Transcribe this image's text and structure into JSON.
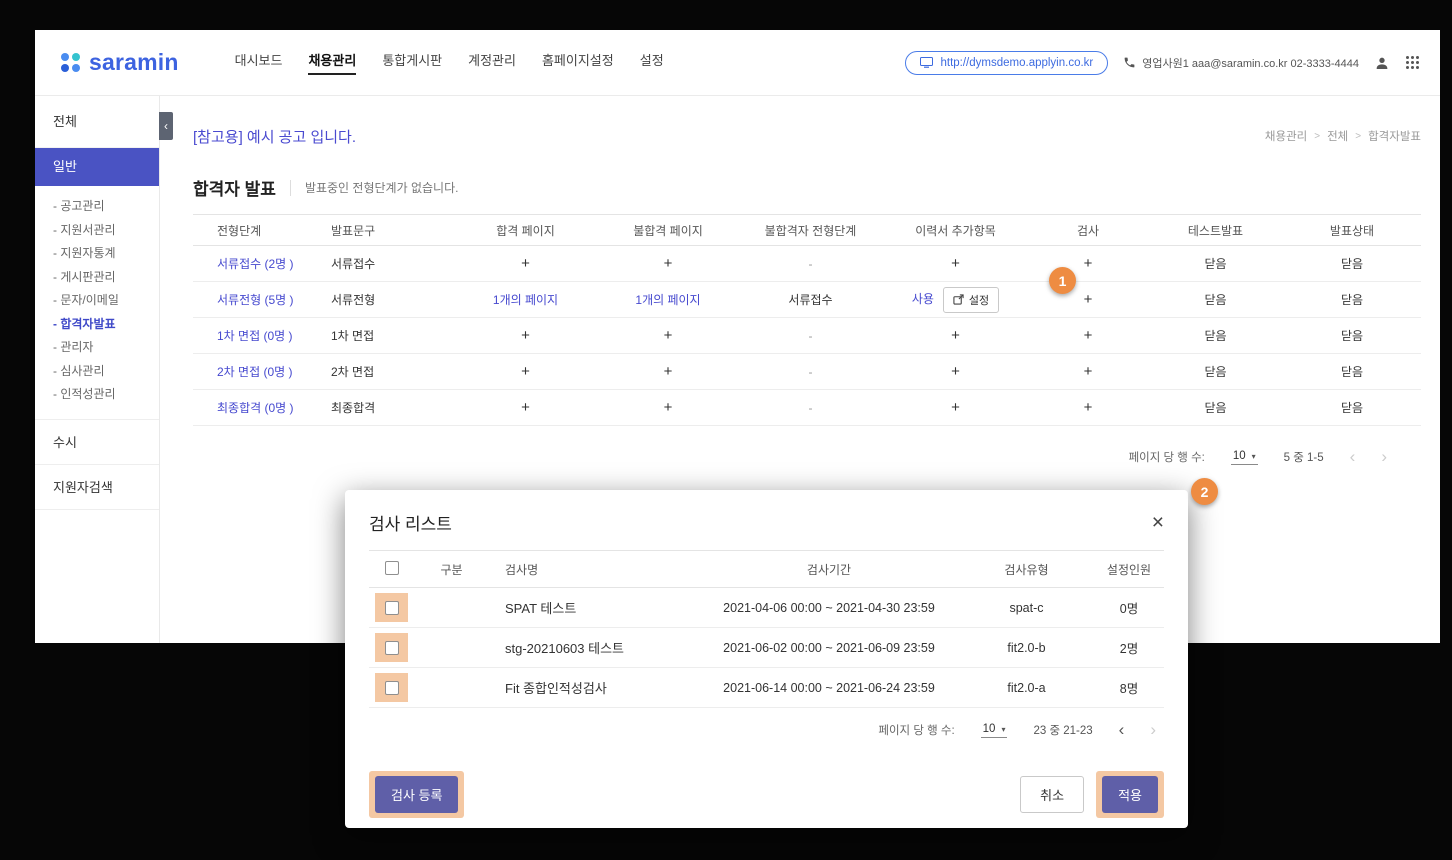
{
  "colors": {
    "primary_indigo": "#4a53c3",
    "link_blue": "#4649cf",
    "brand_blue": "#3d63e0",
    "badge_orange": "#ee8c42",
    "highlight_peach": "#f4c8a3"
  },
  "header": {
    "logo": "saramin",
    "nav": [
      {
        "label": "대시보드"
      },
      {
        "label": "채용관리"
      },
      {
        "label": "통합게시판"
      },
      {
        "label": "계정관리"
      },
      {
        "label": "홈페이지설정"
      },
      {
        "label": "설정"
      }
    ],
    "site_url": "http://dymsdemo.applyin.co.kr",
    "contact": "영업사원1 aaa@saramin.co.kr 02-3333-4444"
  },
  "sidebar": {
    "all_label": "전체",
    "collapse_icon": "‹",
    "group_label": "일반",
    "items": [
      {
        "label": "- 공고관리"
      },
      {
        "label": "- 지원서관리"
      },
      {
        "label": "- 지원자통계"
      },
      {
        "label": "- 게시판관리"
      },
      {
        "label": "- 문자/이메일"
      },
      {
        "label": "- 합격자발표"
      },
      {
        "label": "- 관리자"
      },
      {
        "label": "- 심사관리"
      },
      {
        "label": "- 인적성관리"
      }
    ],
    "susi_label": "수시",
    "search_label": "지원자검색"
  },
  "page": {
    "notice_title": "[참고용] 예시 공고 입니다.",
    "breadcrumb": {
      "a": "채용관리",
      "b": "전체",
      "c": "합격자발표",
      "sep": ">"
    },
    "section_title": "합격자 발표",
    "section_note": "발표중인 전형단계가 없습니다."
  },
  "announce": {
    "columns": [
      "전형단계",
      "발표문구",
      "합격 페이지",
      "불합격 페이지",
      "불합격자 전형단계",
      "이력서 추가항목",
      "검사",
      "테스트발표",
      "발표상태"
    ],
    "rows": [
      {
        "stage": "서류접수 (2명 )",
        "phrase": "서류접수",
        "pass": "+",
        "fail": "+",
        "fail_stage": "-",
        "resume": "+",
        "test": "+",
        "test_open": "닫음",
        "status": "닫음"
      },
      {
        "stage": "서류전형 (5명 )",
        "phrase": "서류전형",
        "pass": "1개의 페이지",
        "fail": "1개의 페이지",
        "fail_stage": "서류접수",
        "resume_use": "사용",
        "resume_btn": "설정",
        "test": "+",
        "test_open": "닫음",
        "status": "닫음"
      },
      {
        "stage": "1차 면접 (0명 )",
        "phrase": "1차 면접",
        "pass": "+",
        "fail": "+",
        "fail_stage": "-",
        "resume": "+",
        "test": "+",
        "test_open": "닫음",
        "status": "닫음"
      },
      {
        "stage": "2차 면접 (0명 )",
        "phrase": "2차 면접",
        "pass": "+",
        "fail": "+",
        "fail_stage": "-",
        "resume": "+",
        "test": "+",
        "test_open": "닫음",
        "status": "닫음"
      },
      {
        "stage": "최종합격 (0명 )",
        "phrase": "최종합격",
        "pass": "+",
        "fail": "+",
        "fail_stage": "-",
        "resume": "+",
        "test": "+",
        "test_open": "닫음",
        "status": "닫음"
      }
    ],
    "pagination": {
      "label": "페이지 당 행 수:",
      "value": "10",
      "caret": "▾",
      "range": "5 중 1-5",
      "prev": "‹",
      "next": "›"
    }
  },
  "modal": {
    "title": "검사 리스트",
    "close": "×",
    "columns": [
      "구분",
      "검사명",
      "검사기간",
      "검사유형",
      "설정인원"
    ],
    "rows": [
      {
        "name": "SPAT 테스트",
        "period": "2021-04-06 00:00 ~ 2021-04-30 23:59",
        "type": "spat-c",
        "count": "0명"
      },
      {
        "name": "stg-20210603 테스트",
        "period": "2021-06-02 00:00 ~ 2021-06-09 23:59",
        "type": "fit2.0-b",
        "count": "2명"
      },
      {
        "name": "Fit 종합인적성검사",
        "period": "2021-06-14 00:00 ~ 2021-06-24 23:59",
        "type": "fit2.0-a",
        "count": "8명"
      }
    ],
    "pagination": {
      "label": "페이지 당 행 수:",
      "value": "10",
      "caret": "▾",
      "range": "23 중 21-23",
      "prev": "‹",
      "next": "›"
    },
    "register_button": "검사 등록",
    "cancel_button": "취소",
    "apply_button": "적용"
  },
  "annotations": {
    "badge1": "1",
    "badge2": "2"
  }
}
